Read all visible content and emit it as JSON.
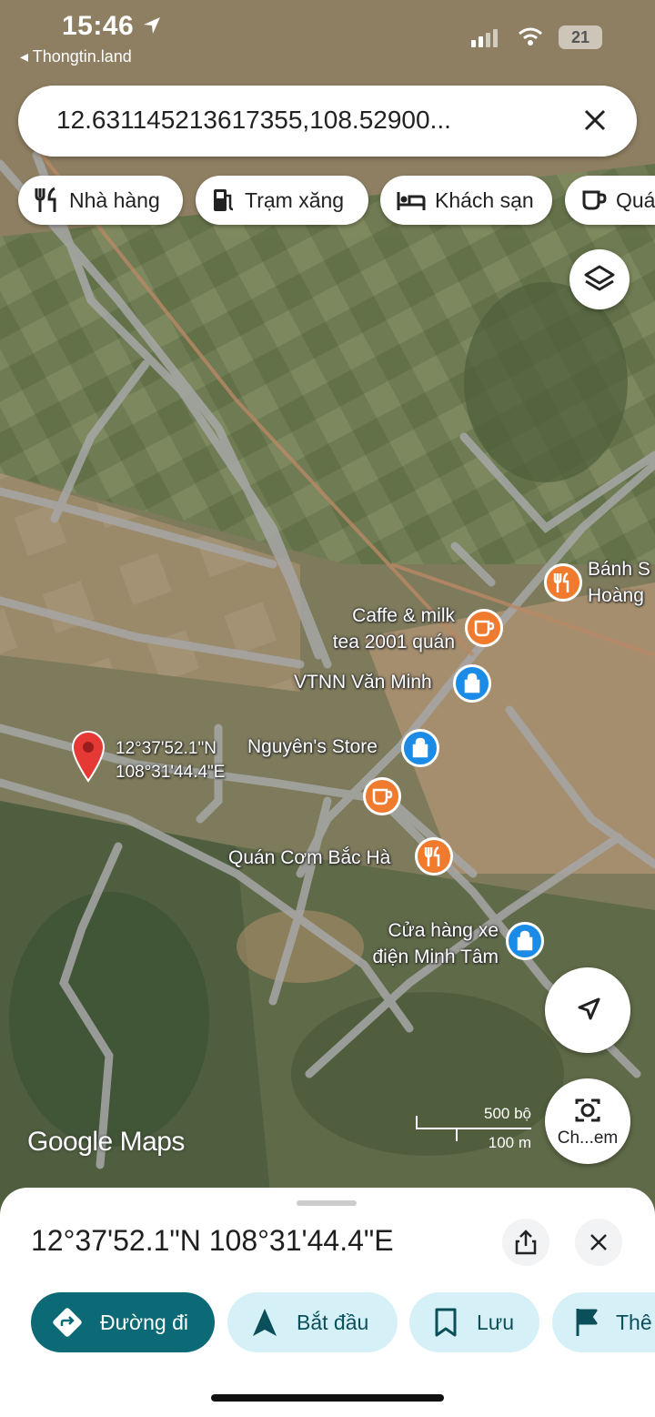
{
  "status_bar": {
    "time": "15:46",
    "back_label": "◂ Thongtin.land",
    "battery": "21"
  },
  "search": {
    "query": "12.631145213617355,108.52900..."
  },
  "chips": [
    {
      "label": "Nhà hàng",
      "icon": "fork-knife-icon"
    },
    {
      "label": "Trạm xăng",
      "icon": "gas-station-icon"
    },
    {
      "label": "Khách sạn",
      "icon": "bed-icon"
    },
    {
      "label": "Quá",
      "icon": "coffee-cup-icon"
    }
  ],
  "map": {
    "pin": {
      "lat_label": "12°37'52.1\"N",
      "lng_label": "108°31'44.4\"E"
    },
    "pois": [
      {
        "name": "Bánh S",
        "name2": "Hoàng",
        "type": "restaurant",
        "color": "#f07a2d"
      },
      {
        "name": "Caffe & milk",
        "name2": "tea 2001 quán",
        "type": "cafe",
        "color": "#f07a2d"
      },
      {
        "name": "VTNN Văn Minh",
        "type": "shopping",
        "color": "#1a8be6"
      },
      {
        "name": "Nguyên's Store",
        "type": "shopping",
        "color": "#1a8be6"
      },
      {
        "name": "",
        "type": "cafe",
        "color": "#f07a2d"
      },
      {
        "name": "Quán Cơm Bắc Hà",
        "type": "restaurant",
        "color": "#f07a2d"
      },
      {
        "name": "Cửa hàng xe",
        "name2": "điện Minh Tâm",
        "type": "shopping",
        "color": "#1a8be6"
      }
    ],
    "logo": "Google Maps",
    "scale": {
      "imperial": "500 bộ",
      "metric": "100 m"
    },
    "camera_button_label": "Ch...em"
  },
  "sheet": {
    "title": "12°37'52.1\"N 108°31'44.4\"E",
    "actions": [
      {
        "label": "Đường đi",
        "icon": "directions-icon"
      },
      {
        "label": "Bắt đầu",
        "icon": "navigate-arrow-icon"
      },
      {
        "label": "Lưu",
        "icon": "bookmark-icon"
      },
      {
        "label": "Thê",
        "icon": "flag-icon"
      }
    ]
  },
  "colors": {
    "primary": "#0b6a76",
    "secondary_bg": "#d5f1f7",
    "pin": "#e53935"
  }
}
